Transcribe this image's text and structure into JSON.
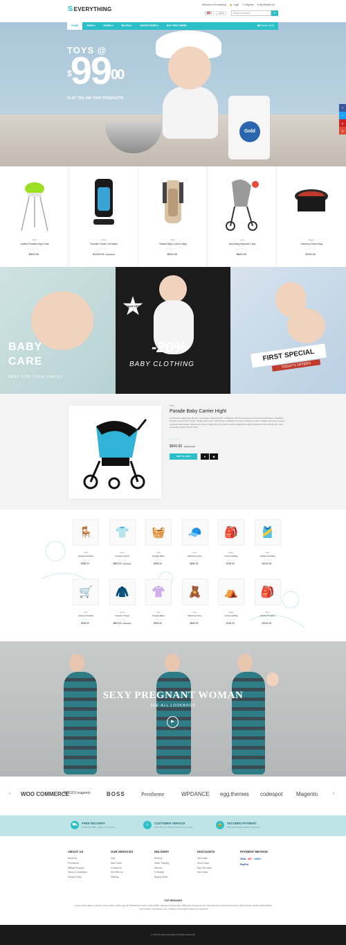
{
  "header": {
    "logo_mark": "S",
    "logo_text": "EVERYTHING",
    "welcome": "Welcome to Everything",
    "login": "Login",
    "register": "Register",
    "wishlist": "My Wishlist (0)",
    "currency": "USD",
    "search_placeholder": "Search products...",
    "nav": [
      "HOME",
      "SHOP ▾",
      "PAGES ▾",
      "BLOGS ▾",
      "SHORTCODES ▾",
      "BUY THIS THEME"
    ],
    "phone": "Phone: 0125"
  },
  "hero": {
    "line1": "TOYS @",
    "price_symbol": "$",
    "price_main": "99",
    "price_cents": "00",
    "line3": "FLAT 75% ON 7000* PRODUCTS",
    "flour_label": "Gold"
  },
  "social": [
    "f",
    "t",
    "p",
    "g"
  ],
  "strip_products": [
    {
      "cat": "Pitch",
      "name": "Juliette Portable High Chair",
      "price": "$900.00",
      "old": ""
    },
    {
      "cat": "Sierra",
      "name": "Traveller Travel Crib Black",
      "price": "$1200.00",
      "old": "$1000.00"
    },
    {
      "cat": "Pitch",
      "name": "Parade Baby Carrier Hight",
      "price": "$900.00",
      "old": ""
    },
    {
      "cat": "Cairo",
      "name": "Nest Baby Bassinet Crips",
      "price": "$650.00",
      "old": ""
    },
    {
      "cat": "Baget",
      "name": "Universal Travel Bag",
      "price": "$230.00",
      "old": ""
    }
  ],
  "banners": {
    "b1_t1": "BABY",
    "b1_t2": "CARE",
    "b1_t3": "BEST FOR YOUR FAMILY",
    "b2_sale": "SALE OFF",
    "b2_t1": "-20%",
    "b2_t2": "BABY CLOTHING",
    "b3_t1": "FIRST SPECIAL",
    "b3_t2": "TODAY'S OFFERS"
  },
  "featured": {
    "cat": "Pitch",
    "name": "Parade Baby Carrier Hight",
    "desc": "Consectetur adipiscing elit sed, consectetur adipiscing elit. Vestibulum ultrices elit sed purus vehicula scelerisque. Phasellus interdum nisl sit amet mattis. Integer odio lorem, ullamcorper vestibulum cursus a, pulvinar ac arcu. Nullam sed ante et augue vehicula pellentesque. Maecenas ornare magna id ipsum lacinia. Morbi vestibulum pulvinar pharetra. Nunc lacinia nisl, vitae venenatis magna velit ac tellus.",
    "price": "$900.00",
    "old": "$1000.00",
    "cart": "ADD TO CART",
    "wish_icon": "♥",
    "view_icon": "◉"
  },
  "grid_products": [
    {
      "cat": "Pitch",
      "name": "Juliette Portable",
      "price": "$900.00",
      "old": ""
    },
    {
      "cat": "Sierra",
      "name": "Traveller Travel",
      "price": "$800.00",
      "old": "$900.00"
    },
    {
      "cat": "Pitch",
      "name": "Parade Baby",
      "price": "$900.00",
      "old": ""
    },
    {
      "cat": "Cairo",
      "name": "Bassinet Crips",
      "price": "$650.00",
      "old": ""
    },
    {
      "cat": "Baget",
      "name": "Universal Bag",
      "price": "$230.00",
      "old": ""
    },
    {
      "cat": "Pitch",
      "name": "Juliette Portable",
      "price": "$1200.00",
      "old": ""
    },
    {
      "cat": "Pitch",
      "name": "Juliette Portable",
      "price": "$900.00",
      "old": ""
    },
    {
      "cat": "Sierra",
      "name": "Traveller Travel",
      "price": "$800.00",
      "old": "$900.00"
    },
    {
      "cat": "Pitch",
      "name": "Parade Baby",
      "price": "$900.00",
      "old": ""
    },
    {
      "cat": "Cairo",
      "name": "Bassinet Crips",
      "price": "$650.00",
      "old": ""
    },
    {
      "cat": "Baget",
      "name": "Universal Bag",
      "price": "$230.00",
      "old": ""
    },
    {
      "cat": "Pitch",
      "name": "Juliette Portable",
      "price": "$1200.00",
      "old": ""
    }
  ],
  "lookbook": {
    "title": "SEXY PREGNANT WOMAN",
    "subtitle": "SEE ALL LOOKBOOK",
    "play": "▶"
  },
  "brands": [
    "WOO COMMERCE",
    "ROCKS magento",
    "BOSS",
    "Prestheme",
    "WPDANCE",
    "egg.themes",
    "codespot",
    "Magento"
  ],
  "arrows": {
    "prev": "‹",
    "next": "›"
  },
  "features": [
    {
      "icon": "⛟",
      "title": "FREE DELIVERY",
      "text": "On all over $99 - apply on the online"
    },
    {
      "icon": "☺",
      "title": "CUSTOMER SERVICE",
      "text": "Give with your friends whenever go home"
    },
    {
      "icon": "🔒",
      "title": "SECURED PAYMENT",
      "text": "Safe and Secure checkout payment"
    }
  ],
  "footer": {
    "cols": [
      {
        "title": "ABOUT US",
        "links": [
          "About Us",
          "Promotions",
          "Affiliate Program",
          "Terms & Conditions",
          "Privacy Policy"
        ]
      },
      {
        "title": "OUR SERVICES",
        "links": [
          "FAQ",
          "Size Guide",
          "Contact Us",
          "Sell With Us",
          "Sitemap"
        ]
      },
      {
        "title": "DELIVERY",
        "links": [
          "Delivery",
          "Order Tracking",
          "Returns",
          "E-Receipt",
          "Buying Guide"
        ]
      },
      {
        "title": "DISCOUNTS",
        "links": [
          "Gift Cards",
          "Store Cards",
          "Buy Gift Cards",
          "Use Cards"
        ]
      }
    ],
    "payment_title": "PAYMENT METHOD",
    "payments": [
      "VISA",
      "MC",
      "AMEX",
      "PayPal"
    ],
    "top_brands_title": "TOP BRANDS",
    "top_brands_links": "Luxury goods | Bags on wheels | Luxury bikes | Johnny wig kill | Philanthropic sense | Acca & With | Valentino persona | Mom. Baby-kids | Supportive line | Superstar fine | Accessories & boots | Suits & Jewel | Fashion with suitables | Out of better | Connection to us | Invitation | And lengths | Glamorous cosmetics",
    "copyright": "© 2015 Shopify Everything. All Rights Reserved."
  }
}
